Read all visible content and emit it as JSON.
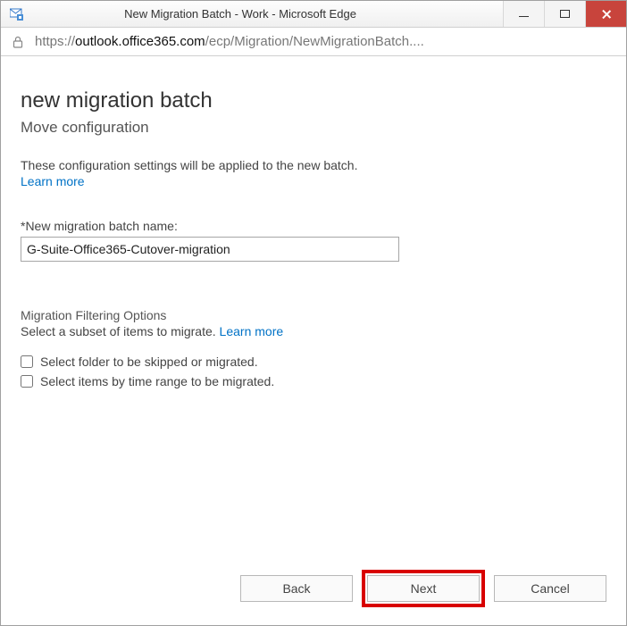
{
  "window": {
    "title": "New Migration Batch - Work - Microsoft Edge"
  },
  "address": {
    "protocol": "https://",
    "host": "outlook.office365.com",
    "path": "/ecp/Migration/NewMigrationBatch...."
  },
  "page": {
    "heading": "new migration batch",
    "subheading": "Move configuration",
    "description": "These configuration settings will be applied to the new batch.",
    "learn_more": "Learn more",
    "batch_name_label": "*New migration batch name:",
    "batch_name_value": "G-Suite-Office365-Cutover-migration",
    "filter_title": "Migration Filtering Options",
    "filter_sub": "Select a subset of items to migrate.",
    "filter_learn_more": "Learn more",
    "checkbox1_label": "Select folder to be skipped or migrated.",
    "checkbox2_label": "Select items by time range to be migrated."
  },
  "buttons": {
    "back": "Back",
    "next": "Next",
    "cancel": "Cancel"
  }
}
